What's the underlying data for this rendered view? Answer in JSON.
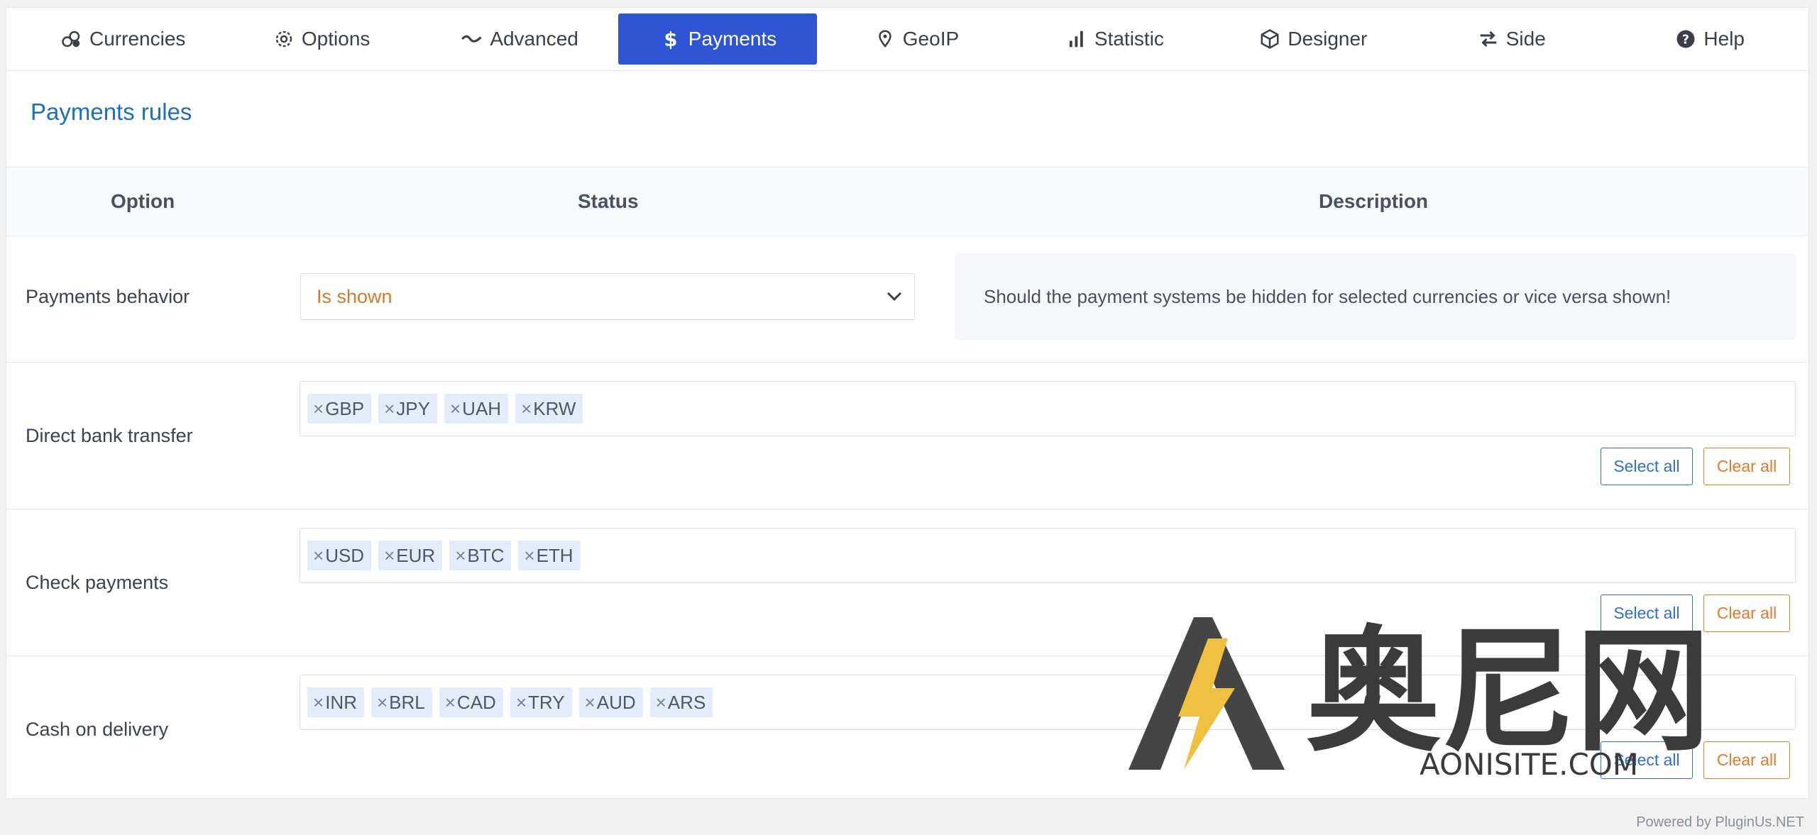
{
  "tabs": [
    {
      "label": "Currencies",
      "icon": "coins-icon"
    },
    {
      "label": "Options",
      "icon": "gear-icon"
    },
    {
      "label": "Advanced",
      "icon": "wave-icon"
    },
    {
      "label": "Payments",
      "icon": "dollar-icon",
      "active": true
    },
    {
      "label": "GeoIP",
      "icon": "map-pin-icon"
    },
    {
      "label": "Statistic",
      "icon": "bar-chart-icon"
    },
    {
      "label": "Designer",
      "icon": "cube-icon"
    },
    {
      "label": "Side",
      "icon": "arrows-icon"
    },
    {
      "label": "Help",
      "icon": "question-icon"
    }
  ],
  "section_title": "Payments rules",
  "table": {
    "headers": {
      "option": "Option",
      "status": "Status",
      "description": "Description"
    },
    "behavior": {
      "label": "Payments behavior",
      "value": "Is shown",
      "description": "Should the payment systems be hidden for selected currencies or vice versa shown!"
    },
    "rows": [
      {
        "label": "Direct bank transfer",
        "tags": [
          "GBP",
          "JPY",
          "UAH",
          "KRW"
        ]
      },
      {
        "label": "Check payments",
        "tags": [
          "USD",
          "EUR",
          "BTC",
          "ETH"
        ]
      },
      {
        "label": "Cash on delivery",
        "tags": [
          "INR",
          "BRL",
          "CAD",
          "TRY",
          "AUD",
          "ARS"
        ]
      }
    ],
    "select_all_label": "Select all",
    "clear_all_label": "Clear all"
  },
  "watermark": {
    "text": "奥尼网",
    "sub": "AONISITE.COM"
  },
  "footer": "Powered by PluginUs.NET",
  "colors": {
    "accent": "#2f55d4",
    "title": "#1f6fb8",
    "select_value": "#d37a2b",
    "clear": "#e07a2e"
  }
}
